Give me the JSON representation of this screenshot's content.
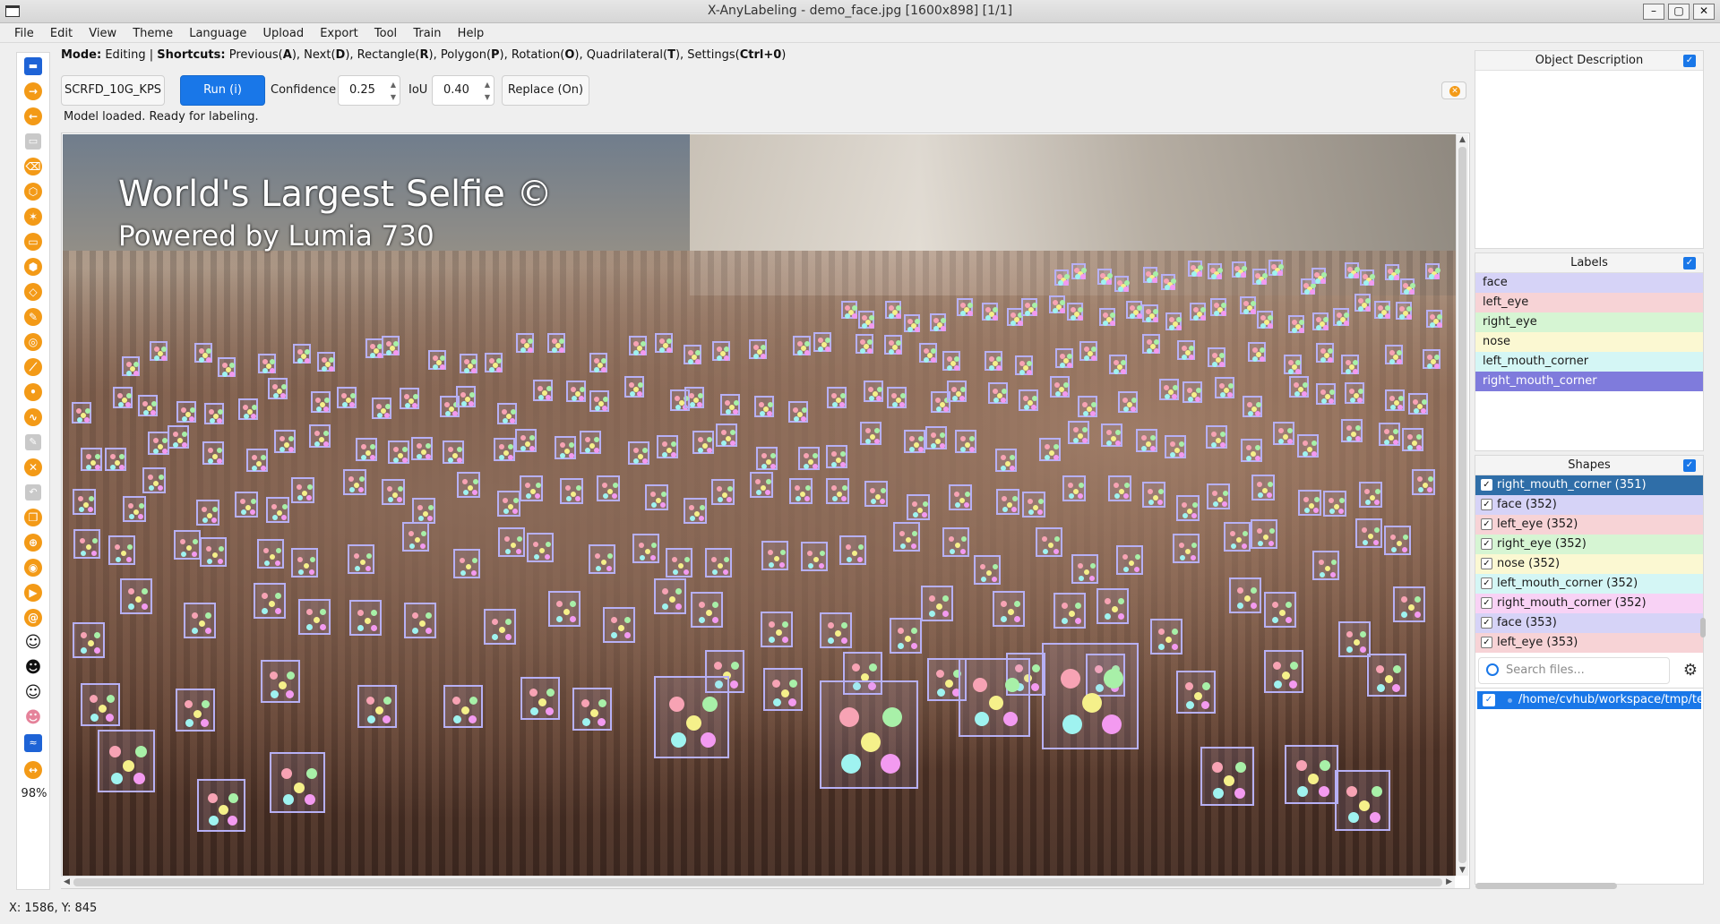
{
  "window": {
    "title": "X-AnyLabeling - demo_face.jpg [1600x898] [1/1]",
    "controls": [
      "–",
      "▢",
      "✕"
    ]
  },
  "menu": [
    "File",
    "Edit",
    "View",
    "Theme",
    "Language",
    "Upload",
    "Export",
    "Tool",
    "Train",
    "Help"
  ],
  "mode_line": {
    "mode_label": "Mode:",
    "mode_value": "Editing",
    "sep": "|",
    "shortcuts_label": "Shortcuts:",
    "shortcuts": [
      {
        "name": "Previous(",
        "key": "A",
        "end": "), "
      },
      {
        "name": "Next(",
        "key": "D",
        "end": "), "
      },
      {
        "name": "Rectangle(",
        "key": "R",
        "end": "), "
      },
      {
        "name": "Polygon(",
        "key": "P",
        "end": "), "
      },
      {
        "name": "Rotation(",
        "key": "O",
        "end": "), "
      },
      {
        "name": "Quadrilateral(",
        "key": "T",
        "end": "), "
      },
      {
        "name": "Settings(",
        "key": "Ctrl+0",
        "end": ")"
      }
    ]
  },
  "model_bar": {
    "model_name": "SCRFD_10G_KPS",
    "run_label": "Run (i)",
    "confidence_label": "Confidence",
    "confidence_value": "0.25",
    "iou_label": "IoU",
    "iou_value": "0.40",
    "replace_label": "Replace (On)",
    "status": "Model loaded. Ready for labeling."
  },
  "canvas": {
    "watermark_title": "World's Largest Selfie ©",
    "watermark_subtitle": "Powered by Lumia 730"
  },
  "toolbar": {
    "zoom": "98%"
  },
  "status_bar": {
    "coords": "X: 1586, Y: 845"
  },
  "panels": {
    "object_description": {
      "title": "Object Description"
    },
    "labels": {
      "title": "Labels",
      "items": [
        {
          "name": "face",
          "color": "#d6d3f7"
        },
        {
          "name": "left_eye",
          "color": "#f7d3d6"
        },
        {
          "name": "right_eye",
          "color": "#d6f5d3"
        },
        {
          "name": "nose",
          "color": "#fbf8d2"
        },
        {
          "name": "left_mouth_corner",
          "color": "#d4f6f5"
        },
        {
          "name": "right_mouth_corner",
          "color": "#7f7bdc"
        }
      ]
    },
    "shapes": {
      "title": "Shapes",
      "items": [
        {
          "label": "right_mouth_corner (351)",
          "color": "#2f6ea8",
          "selected": true
        },
        {
          "label": "face (352)",
          "color": "#d6d3f7"
        },
        {
          "label": "left_eye (352)",
          "color": "#f7d3d6"
        },
        {
          "label": "right_eye (352)",
          "color": "#d6f5d3"
        },
        {
          "label": "nose (352)",
          "color": "#fbf8d2"
        },
        {
          "label": "left_mouth_corner (352)",
          "color": "#d4f6f5"
        },
        {
          "label": "right_mouth_corner (352)",
          "color": "#f8d2f5"
        },
        {
          "label": "face (353)",
          "color": "#d6d3f7"
        },
        {
          "label": "left_eye (353)",
          "color": "#f7d3d6"
        }
      ]
    },
    "files": {
      "search_placeholder": "Search files...",
      "items": [
        "/home/cvhub/workspace/tmp/test_"
      ]
    }
  },
  "colors": {
    "accent": "#1977e8",
    "tool_orange": "#f39a17",
    "face_box": "#b7b0f5",
    "kp_left_eye": "#f7a3b4",
    "kp_right_eye": "#a8f0a8",
    "kp_nose": "#f5f08a",
    "kp_left_mouth": "#9ff3f0",
    "kp_right_mouth": "#f39af0"
  }
}
